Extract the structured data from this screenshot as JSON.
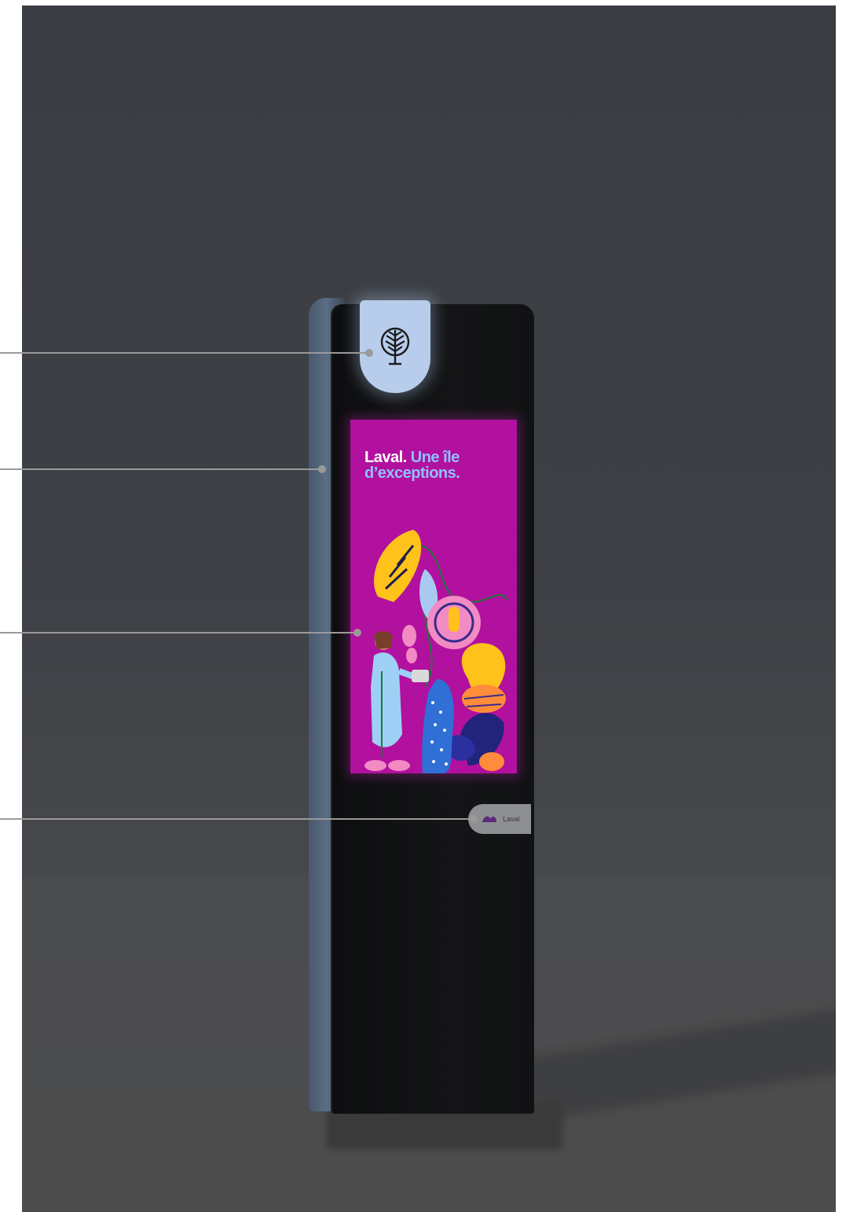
{
  "screen": {
    "headline_strong": "Laval.",
    "headline_accent_line1": " Une île",
    "headline_accent_line2": "d’exceptions."
  },
  "badge": {
    "text": "Laval"
  },
  "colors": {
    "cap_light": "#b7cdeb",
    "screen_magenta": "#b2109e",
    "accent_blue": "#8fc0ff",
    "callout_gray": "#9a9a9a"
  },
  "icons": [
    "tree-icon",
    "laval-logo-icon"
  ]
}
